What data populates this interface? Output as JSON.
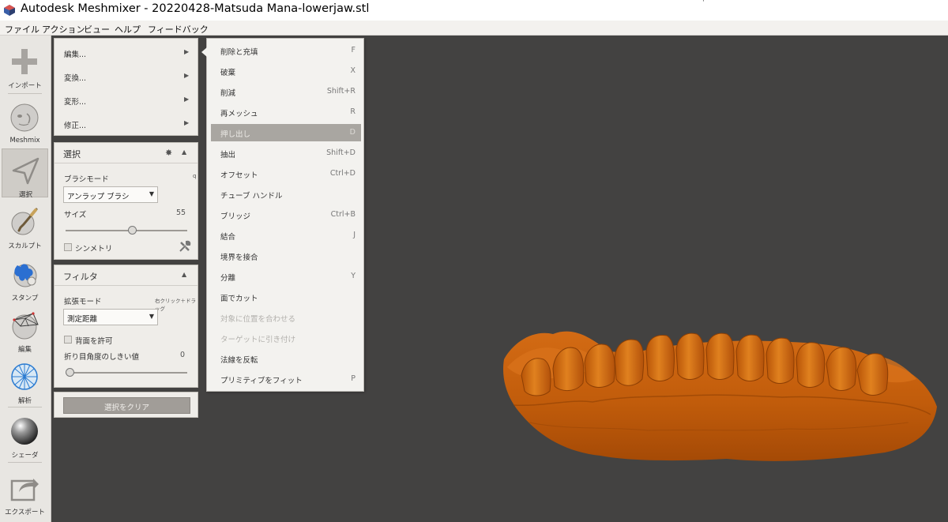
{
  "window": {
    "title": "Autodesk Meshmixer - 20220428-Matsuda Mana-lowerjaw.stl",
    "app_icon": "meshmixer-logo-icon",
    "corner_mark": "'"
  },
  "menubar": [
    {
      "label": "ファイル"
    },
    {
      "label": "アクション"
    },
    {
      "label": "ビュー"
    },
    {
      "label": "ヘルプ"
    },
    {
      "label": "フィードバック"
    }
  ],
  "toolbar": [
    {
      "label": "インポート",
      "icon": "plus-icon",
      "active": false
    },
    {
      "label": "Meshmix",
      "icon": "meshmix-head-icon",
      "active": false
    },
    {
      "label": "選択",
      "icon": "select-arrow-icon",
      "active": true
    },
    {
      "label": "スカルプト",
      "icon": "sculpt-brush-icon",
      "active": false
    },
    {
      "label": "スタンプ",
      "icon": "stamp-icon",
      "active": false
    },
    {
      "label": "編集",
      "icon": "edit-mesh-icon",
      "active": false
    },
    {
      "label": "解析",
      "icon": "analysis-icon",
      "active": false
    },
    {
      "label": "シェーダ",
      "icon": "shader-sphere-icon",
      "active": false
    },
    {
      "label": "エクスポート",
      "icon": "export-icon",
      "active": false
    }
  ],
  "edit_menu": [
    {
      "label": "編集..."
    },
    {
      "label": "変換..."
    },
    {
      "label": "変形..."
    },
    {
      "label": "修正..."
    }
  ],
  "select_panel": {
    "title": "選択",
    "brush_mode_label": "ブラシモード",
    "brush_mode_hint": "q",
    "brush_mode_value": "アンラップ ブラシ",
    "size_label": "サイズ",
    "size_value": "55",
    "size_fraction": 0.55,
    "symmetry_label": "シンメトリ",
    "symmetry_checked": false
  },
  "filter_panel": {
    "title": "フィルタ",
    "expand_mode_label": "拡張モード",
    "expand_mode_hint": "右クリック＋ドラッグ",
    "expand_mode_value": "測定距離",
    "allow_back_label": "背面を許可",
    "allow_back_checked": false,
    "crease_label": "折り目角度のしきい値",
    "crease_value": "0",
    "crease_fraction": 0.0
  },
  "clear_button": {
    "label": "選択をクリア"
  },
  "submenu": [
    {
      "label": "削除と充填",
      "shortcut": "F",
      "state": "normal"
    },
    {
      "label": "破棄",
      "shortcut": "X",
      "state": "normal"
    },
    {
      "label": "削減",
      "shortcut": "Shift+R",
      "state": "normal"
    },
    {
      "label": "再メッシュ",
      "shortcut": "R",
      "state": "normal"
    },
    {
      "label": "押し出し",
      "shortcut": "D",
      "state": "highlighted"
    },
    {
      "label": "抽出",
      "shortcut": "Shift+D",
      "state": "normal"
    },
    {
      "label": "オフセット",
      "shortcut": "Ctrl+D",
      "state": "normal"
    },
    {
      "label": "チューブ ハンドル",
      "shortcut": "",
      "state": "normal"
    },
    {
      "label": "ブリッジ",
      "shortcut": "Ctrl+B",
      "state": "normal"
    },
    {
      "label": "結合",
      "shortcut": "J",
      "state": "normal"
    },
    {
      "label": "境界を接合",
      "shortcut": "",
      "state": "normal"
    },
    {
      "label": "分離",
      "shortcut": "Y",
      "state": "normal"
    },
    {
      "label": "面でカット",
      "shortcut": "",
      "state": "normal"
    },
    {
      "label": "対象に位置を合わせる",
      "shortcut": "",
      "state": "disabled"
    },
    {
      "label": "ターゲットに引き付け",
      "shortcut": "",
      "state": "disabled"
    },
    {
      "label": "法線を反転",
      "shortcut": "",
      "state": "normal"
    },
    {
      "label": "プリミティブをフィット",
      "shortcut": "P",
      "state": "normal"
    }
  ],
  "colors": {
    "viewport_bg": "#434241",
    "panel_bg": "#efede9",
    "mesh": "#c85f0d",
    "highlight": "#a9a6a1",
    "button": "#a19d98"
  }
}
